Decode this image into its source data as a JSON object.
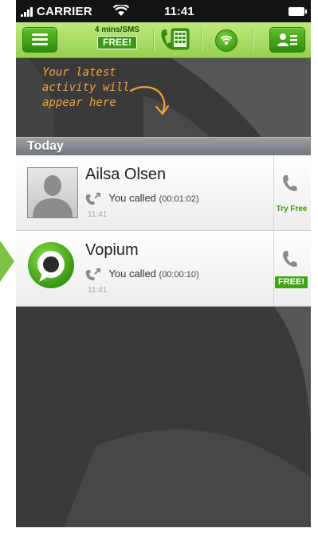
{
  "status_bar": {
    "carrier": "CARRIER",
    "time": "11:41"
  },
  "nav_bar": {
    "promo_text": "4 mins/SMS",
    "promo_badge": "FREE!"
  },
  "hint": {
    "line1": "Your latest",
    "line2": "activity will",
    "line3": "appear here"
  },
  "section": {
    "title": "Today"
  },
  "calls": [
    {
      "name": "Ailsa Olsen",
      "detail": "You called",
      "duration": "(00:01:02)",
      "time": "11:41",
      "action_label": "Try Free",
      "avatar": "person-placeholder-icon"
    },
    {
      "name": "Vopium",
      "detail": "You called",
      "duration": "(00:00:10)",
      "time": "11:41",
      "action_label": "FREE!",
      "avatar": "vopium-logo"
    }
  ],
  "colors": {
    "brand_green": "#3ea510",
    "hint_orange": "#f2a33a",
    "nav_green_light": "#bfe97c"
  }
}
